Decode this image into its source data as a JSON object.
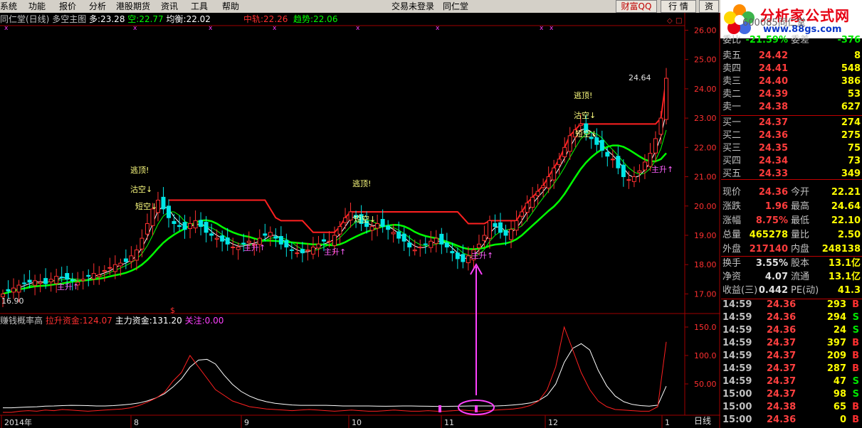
{
  "menu": [
    "系统",
    "功能",
    "报价",
    "分析",
    "港股期货",
    "资讯",
    "工具",
    "帮助"
  ],
  "menu_center": "交易未登录",
  "menu_stock": "同仁堂",
  "buttons": {
    "qq": "财富QQ",
    "quote": "行 情",
    "info": "资"
  },
  "logo": {
    "title": "分析家公式网",
    "url": "www.88gs.com"
  },
  "main_info": {
    "name": "同仁堂(日线)",
    "chart": "多空主图",
    "duo_label": "多:",
    "duo_value": "23.28",
    "kong_label": "空:",
    "kong_value": "22.77",
    "jh_label": "均衡:",
    "jh_value": "22.02",
    "zg_label": "中轨:",
    "zg_value": "22.26",
    "qs_label": "趋势:",
    "qs_value": "22.06"
  },
  "sub_info": {
    "name": "赚钱概率高",
    "lf_label": "拉升资金:",
    "lf_value": "124.07",
    "zl_label": "主力资金:",
    "zl_value": "131.20",
    "gz_label": "关注:",
    "gz_value": "0.00"
  },
  "price_axis": [
    "26.00",
    "25.00",
    "24.00",
    "23.00",
    "22.00",
    "21.00",
    "20.00",
    "19.00",
    "18.00",
    "17.00"
  ],
  "sub_axis": [
    "150.0",
    "100.0",
    "50.00"
  ],
  "x_axis": [
    "2014年",
    "8",
    "9",
    "10",
    "11",
    "12",
    "1"
  ],
  "period_label": "日线",
  "annotations": {
    "peak": "24.64",
    "low": "16.90",
    "escape": "逃顶!",
    "sell": "沽空↓",
    "short": "短空↓",
    "short2": "短空↓",
    "up": "主升↑",
    "dollar": "$"
  },
  "book_header": {
    "code": "600085",
    "name": "同仁堂",
    "wb_label": "委比",
    "wb_value": "-21.59%",
    "wc_label": "委差",
    "wc_value": "-376"
  },
  "asks": [
    {
      "label": "卖五",
      "price": "24.42",
      "vol": "8"
    },
    {
      "label": "卖四",
      "price": "24.41",
      "vol": "548"
    },
    {
      "label": "卖三",
      "price": "24.40",
      "vol": "386"
    },
    {
      "label": "卖二",
      "price": "24.39",
      "vol": "53"
    },
    {
      "label": "卖一",
      "price": "24.38",
      "vol": "627"
    }
  ],
  "bids": [
    {
      "label": "买一",
      "price": "24.37",
      "vol": "274"
    },
    {
      "label": "买二",
      "price": "24.36",
      "vol": "275"
    },
    {
      "label": "买三",
      "price": "24.35",
      "vol": "75"
    },
    {
      "label": "买四",
      "price": "24.34",
      "vol": "73"
    },
    {
      "label": "买五",
      "price": "24.33",
      "vol": "349"
    }
  ],
  "stats": [
    {
      "l1": "现价",
      "v1": "24.36",
      "c1": "red",
      "l2": "今开",
      "v2": "22.21",
      "c2": "green"
    },
    {
      "l1": "涨跌",
      "v1": "1.96",
      "c1": "red",
      "l2": "最高",
      "v2": "24.64",
      "c2": "red"
    },
    {
      "l1": "涨幅",
      "v1": "8.75%",
      "c1": "red",
      "l2": "最低",
      "v2": "22.10",
      "c2": "green"
    },
    {
      "l1": "总量",
      "v1": "465278",
      "c1": "yellow",
      "l2": "量比",
      "v2": "2.50",
      "c2": "red"
    },
    {
      "l1": "外盘",
      "v1": "217140",
      "c1": "red",
      "l2": "内盘",
      "v2": "248138",
      "c2": "green"
    }
  ],
  "stats2": [
    {
      "l1": "换手",
      "v1": "3.55%",
      "c1": "white",
      "l2": "股本",
      "v2": "13.1亿",
      "c2": "white"
    },
    {
      "l1": "净资",
      "v1": "4.07",
      "c1": "white",
      "l2": "流通",
      "v2": "13.1亿",
      "c2": "white"
    },
    {
      "l1": "收益(三)",
      "v1": "0.442",
      "c1": "white",
      "l2": "PE(动)",
      "v2": "41.3",
      "c2": "white"
    }
  ],
  "ticks": [
    {
      "t": "14:59",
      "p": "24.36",
      "v": "293",
      "d": "B"
    },
    {
      "t": "14:59",
      "p": "24.36",
      "v": "294",
      "d": "S"
    },
    {
      "t": "14:59",
      "p": "24.36",
      "v": "24",
      "d": "S"
    },
    {
      "t": "14:59",
      "p": "24.37",
      "v": "397",
      "d": "B"
    },
    {
      "t": "14:59",
      "p": "24.37",
      "v": "209",
      "d": "B"
    },
    {
      "t": "14:59",
      "p": "24.37",
      "v": "287",
      "d": "B"
    },
    {
      "t": "14:59",
      "p": "24.37",
      "v": "47",
      "d": "S"
    },
    {
      "t": "15:00",
      "p": "24.37",
      "v": "98",
      "d": "S"
    },
    {
      "t": "15:00",
      "p": "24.38",
      "v": "65",
      "d": "B"
    },
    {
      "t": "15:00",
      "p": "24.36",
      "v": "0",
      "d": "B"
    }
  ],
  "chart_data": {
    "type": "candlestick",
    "ylim": [
      16.5,
      26.4
    ],
    "x_ticks": [
      "2014年",
      "8",
      "9",
      "10",
      "11",
      "12",
      "1"
    ],
    "close": [
      17.0,
      17.1,
      17.2,
      17.3,
      17.35,
      17.4,
      17.45,
      17.4,
      17.35,
      17.5,
      17.6,
      17.55,
      17.5,
      17.45,
      17.4,
      17.5,
      17.6,
      17.7,
      17.65,
      17.8,
      17.9,
      18.0,
      18.05,
      18.1,
      18.3,
      18.5,
      18.9,
      19.4,
      19.9,
      20.2,
      19.9,
      19.6,
      19.4,
      19.3,
      19.2,
      19.4,
      19.5,
      19.3,
      19.1,
      19.0,
      18.9,
      18.8,
      18.7,
      18.6,
      18.6,
      18.7,
      18.8,
      18.7,
      18.9,
      19.0,
      19.1,
      18.9,
      18.7,
      18.6,
      18.5,
      18.4,
      18.4,
      18.5,
      18.6,
      18.7,
      18.8,
      18.8,
      19.0,
      19.3,
      19.6,
      19.8,
      19.6,
      19.4,
      19.3,
      19.3,
      19.4,
      19.3,
      19.2,
      19.1,
      18.9,
      18.8,
      18.6,
      18.5,
      18.6,
      18.7,
      18.8,
      18.9,
      18.7,
      18.6,
      18.4,
      18.2,
      18.1,
      18.3,
      18.5,
      18.7,
      19.0,
      19.5,
      19.3,
      19.1,
      19.0,
      19.2,
      19.5,
      19.8,
      20.1,
      20.3,
      20.5,
      20.7,
      21.0,
      21.3,
      21.6,
      22.0,
      22.4,
      22.6,
      22.8,
      22.5,
      22.3,
      22.1,
      21.9,
      21.7,
      21.6,
      21.3,
      21.0,
      20.9,
      21.0,
      21.2,
      21.5,
      21.8,
      22.3,
      23.0,
      24.36
    ],
    "escape_markers": [
      "逃顶!",
      "逃顶!",
      "逃顶!"
    ],
    "sub_series": {
      "lf": [
        0,
        0,
        2,
        3,
        2,
        4,
        3,
        5,
        4,
        3,
        2,
        3,
        4,
        5,
        6,
        8,
        12,
        18,
        25,
        35,
        55,
        70,
        100,
        80,
        60,
        40,
        30,
        20,
        15,
        10,
        8,
        6,
        5,
        4,
        3,
        4,
        5,
        4,
        3,
        2,
        3,
        4,
        3,
        2,
        2,
        3,
        4,
        3,
        2,
        2,
        3,
        2,
        2,
        3,
        4,
        3,
        2,
        3,
        4,
        5,
        6,
        8,
        12,
        20,
        40,
        80,
        150,
        110,
        70,
        40,
        20,
        10,
        5,
        4,
        3,
        2,
        2,
        10,
        124
      ]
    },
    "ylim_sub": [
      0,
      165
    ]
  }
}
